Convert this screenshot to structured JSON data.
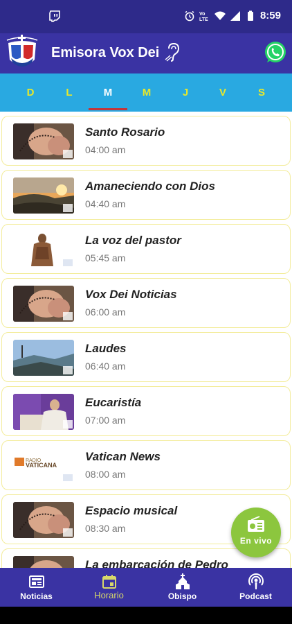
{
  "status_bar": {
    "time": "8:59"
  },
  "app_bar": {
    "title": "Emisora Vox Dei"
  },
  "days": [
    {
      "label": "D",
      "active": false
    },
    {
      "label": "L",
      "active": false
    },
    {
      "label": "M",
      "active": true
    },
    {
      "label": "M",
      "active": false
    },
    {
      "label": "J",
      "active": false
    },
    {
      "label": "V",
      "active": false
    },
    {
      "label": "S",
      "active": false
    }
  ],
  "schedule": [
    {
      "name": "Santo Rosario",
      "time": "04:00 am",
      "thumb": "rosary"
    },
    {
      "name": "Amaneciendo con Dios",
      "time": "04:40 am",
      "thumb": "sunrise"
    },
    {
      "name": "La voz del pastor",
      "time": "05:45 am",
      "thumb": "statue"
    },
    {
      "name": "Vox Dei Noticias",
      "time": "06:00 am",
      "thumb": "rosary"
    },
    {
      "name": "Laudes",
      "time": "06:40 am",
      "thumb": "landscape"
    },
    {
      "name": "Eucaristía",
      "time": "07:00 am",
      "thumb": "mass"
    },
    {
      "name": "Vatican News",
      "time": "08:00 am",
      "thumb": "vatican"
    },
    {
      "name": "Espacio musical",
      "time": "08:30 am",
      "thumb": "rosary"
    },
    {
      "name": "La embarcación de Pedro",
      "time": "",
      "thumb": "rosary"
    }
  ],
  "vatican_logo": {
    "line1": "RADIO",
    "line2": "VATICANA"
  },
  "fab": {
    "label": "En vivo"
  },
  "bottom_nav": [
    {
      "label": "Noticias",
      "icon": "newspaper-icon",
      "active": false
    },
    {
      "label": "Horario",
      "icon": "calendar-icon",
      "active": true
    },
    {
      "label": "Obispo",
      "icon": "church-icon",
      "active": false
    },
    {
      "label": "Podcast",
      "icon": "podcast-icon",
      "active": false
    }
  ],
  "colors": {
    "status_bar": "#2e2a8a",
    "app_bar": "#3a33a3",
    "days_bar": "#29a9e1",
    "day_text": "#e8e82a",
    "day_active": "#ffffff",
    "day_underline": "#c2363a",
    "card_border": "#f3ec9a",
    "fab": "#8cc63e",
    "nav_active": "#d8d96a"
  }
}
